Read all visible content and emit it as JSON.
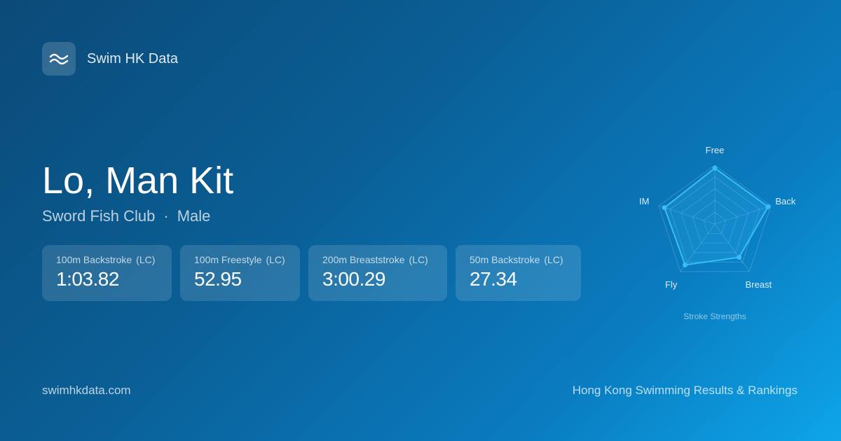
{
  "brand": {
    "name": "Swim HK Data",
    "logo_icon": "wave-icon"
  },
  "swimmer": {
    "name": "Lo, Man Kit",
    "club": "Sword Fish Club",
    "separator": "·",
    "gender": "Male"
  },
  "cards": [
    {
      "event": "100m Backstroke",
      "course": "(LC)",
      "time": "1:03.82"
    },
    {
      "event": "100m Freestyle",
      "course": "(LC)",
      "time": "52.95"
    },
    {
      "event": "200m Breaststroke",
      "course": "(LC)",
      "time": "3:00.29"
    },
    {
      "event": "50m Backstroke",
      "course": "(LC)",
      "time": "27.34"
    }
  ],
  "chart_data": {
    "type": "radar",
    "title": "Stroke Strengths",
    "axes": [
      "Free",
      "Back",
      "Breast",
      "Fly",
      "IM"
    ],
    "values": [
      0.95,
      0.95,
      0.7,
      0.86,
      0.9
    ],
    "range": [
      0,
      1
    ],
    "grid_levels": 5,
    "colors": {
      "line": "#38bdf8",
      "fill": "rgba(56,189,248,0.22)",
      "grid": "rgba(255,255,255,0.18)"
    }
  },
  "footer": {
    "site": "swimhkdata.com",
    "tagline": "Hong Kong Swimming Results & Rankings"
  }
}
